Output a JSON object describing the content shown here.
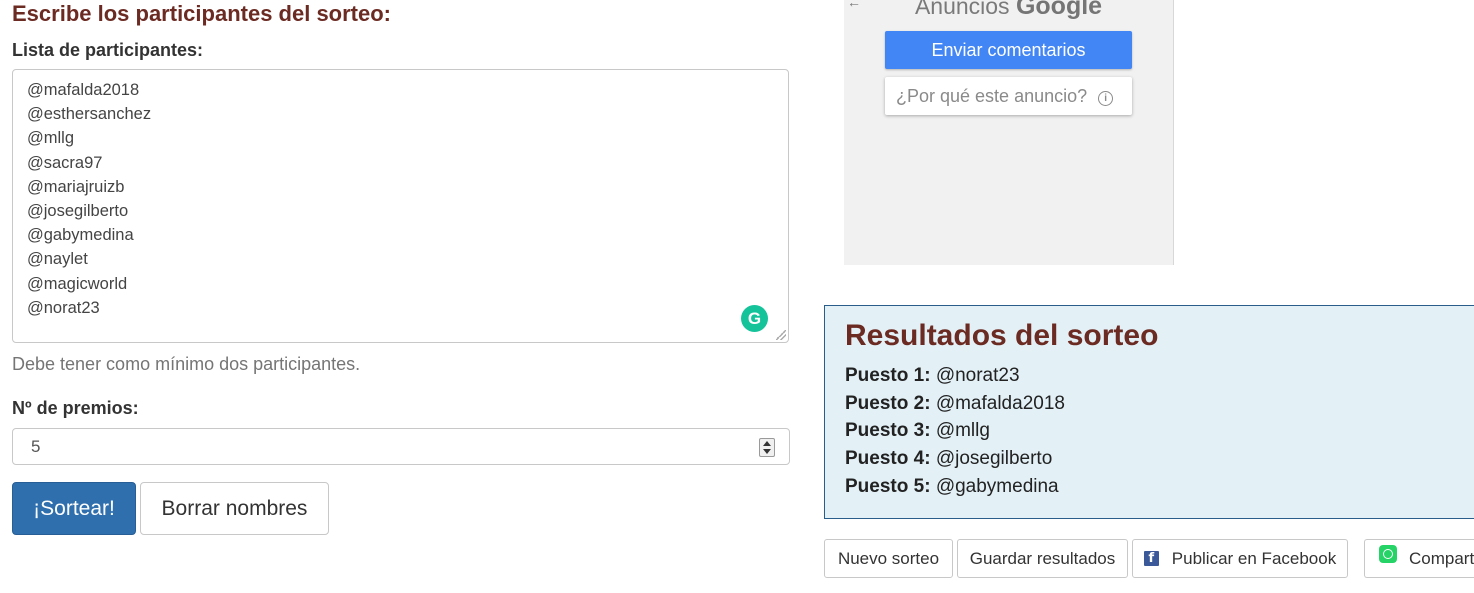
{
  "form": {
    "title": "Escribe los participantes del sorteo:",
    "list_label": "Lista de participantes:",
    "participants": [
      "@mafalda2018",
      "@esthersanchez",
      "@mllg",
      "@sacra97",
      "@mariajruizb",
      "@josegilberto",
      "@gabymedina",
      "@naylet",
      "@magicworld",
      "@norat23"
    ],
    "help_text": "Debe tener como mínimo dos participantes.",
    "prizes_label": "Nº de premios:",
    "prizes_value": "5",
    "draw_button": "¡Sortear!",
    "clear_button": "Borrar nombres",
    "grammarly_glyph": "G"
  },
  "ad": {
    "heading_prefix": "Anuncios",
    "heading_brand": "Google",
    "feedback_button": "Enviar comentarios",
    "why_link": "¿Por qué este anuncio?",
    "info_glyph": "i"
  },
  "results": {
    "title": "Resultados del sorteo",
    "rows": [
      {
        "label": "Puesto 1:",
        "value": "@norat23"
      },
      {
        "label": "Puesto 2:",
        "value": "@mafalda2018"
      },
      {
        "label": "Puesto 3:",
        "value": "@mllg"
      },
      {
        "label": "Puesto 4:",
        "value": "@josegilberto"
      },
      {
        "label": "Puesto 5:",
        "value": "@gabymedina"
      }
    ]
  },
  "actions": {
    "new_draw": "Nuevo sorteo",
    "save_results": "Guardar resultados",
    "facebook": "Publicar en Facebook",
    "facebook_glyph": "f",
    "whatsapp": "Compartir"
  },
  "colors": {
    "title_accent": "#6b2a22",
    "primary_button": "#2f6fae",
    "results_background": "#e3f1f7",
    "ad_button": "#4285f4",
    "facebook_icon": "#3b5998",
    "whatsapp_icon": "#25d366"
  }
}
